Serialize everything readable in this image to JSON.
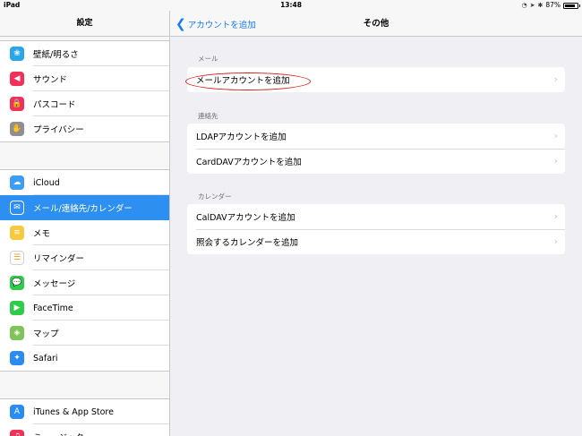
{
  "status_bar": {
    "device": "iPad",
    "time": "13:48",
    "battery_percent": "87%",
    "battery_level": 0.87
  },
  "sidebar": {
    "title": "設定",
    "groups": [
      [
        {
          "label": "壁紙/明るさ",
          "icon": "wallpaper-icon",
          "color": "#2aa6e8",
          "glyph": "❀"
        },
        {
          "label": "サウンド",
          "icon": "sound-icon",
          "color": "#f2315b",
          "glyph": "◀"
        },
        {
          "label": "パスコード",
          "icon": "lock-icon",
          "color": "#f2315b",
          "glyph": "🔒"
        },
        {
          "label": "プライバシー",
          "icon": "hand-icon",
          "color": "#8e8e93",
          "glyph": "✋"
        }
      ],
      [
        {
          "label": "iCloud",
          "icon": "cloud-icon",
          "color": "#3d9cf3",
          "glyph": "☁"
        },
        {
          "label": "メール/連絡先/カレンダー",
          "icon": "mail-icon",
          "color": "#2d8ff0",
          "glyph": "✉",
          "selected": true
        },
        {
          "label": "メモ",
          "icon": "notes-icon",
          "color": "#f6c93f",
          "glyph": "≡"
        },
        {
          "label": "リマインダー",
          "icon": "reminders-icon",
          "color": "#ffffff",
          "glyph": "☰"
        },
        {
          "label": "メッセージ",
          "icon": "messages-icon",
          "color": "#2ecc4a",
          "glyph": "💬"
        },
        {
          "label": "FaceTime",
          "icon": "facetime-icon",
          "color": "#2ecc4a",
          "glyph": "▶"
        },
        {
          "label": "マップ",
          "icon": "maps-icon",
          "color": "#7fc35a",
          "glyph": "◈"
        },
        {
          "label": "Safari",
          "icon": "safari-icon",
          "color": "#2a8cf0",
          "glyph": "✦"
        }
      ],
      [
        {
          "label": "iTunes & App Store",
          "icon": "appstore-icon",
          "color": "#2a8cf0",
          "glyph": "A"
        },
        {
          "label": "ミュージック",
          "icon": "music-icon",
          "color": "#f2315b",
          "glyph": "♫"
        }
      ]
    ]
  },
  "navbar": {
    "back_label": "アカウントを追加",
    "title": "その他"
  },
  "sections": [
    {
      "header": "メール",
      "rows": [
        "メールアカウントを追加"
      ]
    },
    {
      "header": "連絡先",
      "rows": [
        "LDAPアカウントを追加",
        "CardDAVアカウントを追加"
      ]
    },
    {
      "header": "カレンダー",
      "rows": [
        "CalDAVアカウントを追加",
        "照会するカレンダーを追加"
      ]
    }
  ],
  "colors": {
    "accent": "#1a7bf2",
    "selected": "#2d8ff0",
    "annotation": "#d61a1a"
  }
}
